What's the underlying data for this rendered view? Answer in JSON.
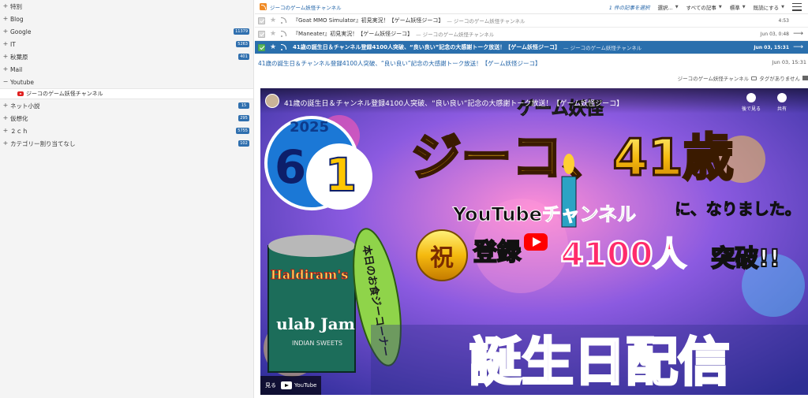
{
  "sidebar": {
    "categories": [
      {
        "toggle": "+",
        "label": "特別",
        "badge": ""
      },
      {
        "toggle": "+",
        "label": "Blog",
        "badge": ""
      },
      {
        "toggle": "+",
        "label": "Google",
        "badge": "11379"
      },
      {
        "toggle": "+",
        "label": "IT",
        "badge": "5263"
      },
      {
        "toggle": "+",
        "label": "秋葉原",
        "badge": "401"
      },
      {
        "toggle": "+",
        "label": "Mail",
        "badge": ""
      },
      {
        "toggle": "−",
        "label": "Youtube",
        "badge": ""
      },
      {
        "toggle": "+",
        "label": "ネット小説",
        "badge": "15"
      },
      {
        "toggle": "+",
        "label": "仮想化",
        "badge": "295"
      },
      {
        "toggle": "+",
        "label": "２ｃｈ",
        "badge": "5755"
      },
      {
        "toggle": "+",
        "label": "カテゴリー割り当てなし",
        "badge": "102"
      }
    ],
    "youtube_feed": "ジーコのゲーム妖怪チャンネル"
  },
  "toolbar": {
    "feed_title": "ジーコのゲーム妖怪チャンネル",
    "selected_count": "1 件の記事を選択",
    "select_menu": "選択...",
    "all_articles": "すべての記事",
    "view_mode": "標準",
    "mark_read": "既読にする"
  },
  "articles": [
    {
      "title": "『Goat MMO Simulator』初見実況！【ゲーム妖怪ジーコ】",
      "source": "— ジーコのゲーム妖怪チャンネル",
      "date": "4:53",
      "selected": false
    },
    {
      "title": "『Maneater』初見実況！【ゲーム妖怪ジーコ】",
      "source": "— ジーコのゲーム妖怪チャンネル",
      "date": "Jun 03, 0:48",
      "selected": false
    },
    {
      "title": "41歳の誕生日＆チャンネル登録4100人突破、“良い良い”記念の大感謝トーク放送！【ゲーム妖怪ジーコ】",
      "source": "— ジーコのゲーム妖怪チャンネル",
      "date": "Jun 03, 15:31",
      "selected": true
    }
  ],
  "article": {
    "title": "41歳の誕生日＆チャンネル登録4100人突破、“良い良い”記念の大感謝トーク放送！【ゲーム妖怪ジーコ】",
    "date": "Jun 03, 15:31",
    "channel": "ジーコのゲーム妖怪チャンネル",
    "tags": "タグがありません"
  },
  "video": {
    "overlay_title": "41歳の誕生日＆チャンネル登録4100人突破、“良い良い”記念の大感謝トーク放送！【ゲーム妖怪ジーコ】",
    "watch_later": "後で見る",
    "share": "共有",
    "watch_on": "見る",
    "youtube": "YouTube",
    "thumb": {
      "year": "2025",
      "month": "6",
      "day": "1",
      "brand": "ゲーム妖怪",
      "headline": "ジーコ、41歳",
      "became": "に、なりました。",
      "yt_channel": "YouTubeチャンネル",
      "reg": "登録",
      "count": "4100人",
      "toppa": "突破!!",
      "shuku": "祝",
      "food": "本日のお食ジーコーナー",
      "product": "Haldiram's",
      "product2": "ulab Jam",
      "product3": "INDIAN SWEETS",
      "big": "誕生日配信"
    }
  },
  "colors": {
    "accent": "#2a6fad",
    "link": "#2264a8",
    "rss": "#f08a24",
    "badge": "#2f6fae"
  }
}
